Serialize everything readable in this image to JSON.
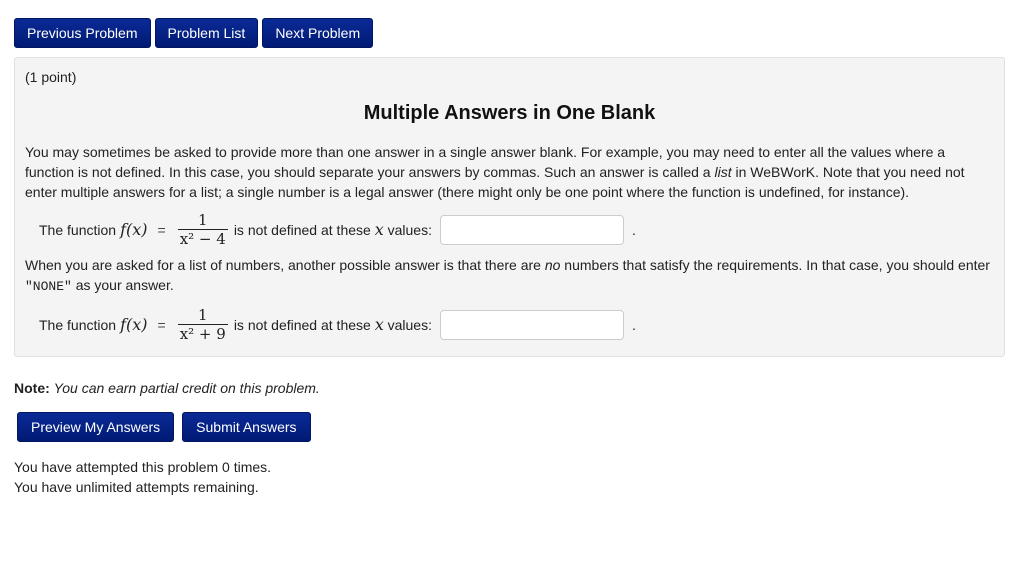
{
  "nav": {
    "previous": "Previous Problem",
    "list": "Problem List",
    "next": "Next Problem"
  },
  "problem": {
    "points": "(1 point)",
    "title": "Multiple Answers in One Blank",
    "para1": {
      "a": "You may sometimes be asked to provide more than one answer in a single answer blank. For example, you may need to enter all the values where a function is not defined. In this case, you should separate your answers by commas. Such an answer is called a ",
      "em": "list",
      "b": " in WeBWorK. Note that you need not enter multiple answers for a list; a single number is a legal answer (there might only be one point where the function is undefined, for instance)."
    },
    "q1": {
      "prefix": "The function",
      "f": "f(x)",
      "eq": "=",
      "numerator": "1",
      "denominator": "x² − 4",
      "middle": "is not defined at these",
      "var": "x",
      "suffix": "values:",
      "answer_value": "",
      "end": "."
    },
    "para2": {
      "a": "When you are asked for a list of numbers, another possible answer is that there are ",
      "em": "no",
      "b": " numbers that satisfy the requirements. In that case, you should enter ",
      "code": "\"NONE\"",
      "c": " as your answer."
    },
    "q2": {
      "prefix": "The function",
      "f": "f(x)",
      "eq": "=",
      "numerator": "1",
      "denominator": "x² + 9",
      "middle": "is not defined at these",
      "var": "x",
      "suffix": "values:",
      "answer_value": "",
      "end": "."
    }
  },
  "note": {
    "label": "Note:",
    "text": "You can earn partial credit on this problem."
  },
  "actions": {
    "preview": "Preview My Answers",
    "submit": "Submit Answers"
  },
  "status": {
    "attempts": "You have attempted this problem 0 times.",
    "remaining": "You have unlimited attempts remaining."
  },
  "colors": {
    "button": "#04207f",
    "panel": "#f4f4f4"
  }
}
